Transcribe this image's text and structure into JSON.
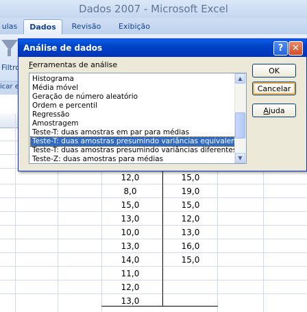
{
  "window": {
    "title": "Dados 2007 - Microsoft Excel"
  },
  "ribbon": {
    "tabs": [
      {
        "label": "ulas"
      },
      {
        "label": "Dados",
        "active": true
      },
      {
        "label": "Revisão"
      },
      {
        "label": "Exibição"
      }
    ],
    "filter_label": "Filtro",
    "group_caption": "icar e"
  },
  "dialog": {
    "title": "Análise de dados",
    "help_label": "?",
    "close_label": "✕",
    "list_label_prefix": "F",
    "list_label_rest": "erramentas de análise",
    "tools": [
      "Histograma",
      "Média móvel",
      "Geração de número aleatório",
      "Ordem e percentil",
      "Regressão",
      "Amostragem",
      "Teste-T: duas amostras em par para médias",
      "Teste-T: duas amostras presumindo variâncias equivalentes",
      "Teste-T: duas amostras presumindo variâncias diferentes",
      "Teste-Z: duas amostras para médias"
    ],
    "selected_index": 7,
    "buttons": {
      "ok": "OK",
      "cancel": "Cancelar",
      "help_prefix": "A",
      "help_rest": "juda"
    }
  },
  "sheet": {
    "col1": [
      "12,0",
      "8,0",
      "15,0",
      "13,0",
      "10,0",
      "13,0",
      "14,0",
      "11,0",
      "12,0",
      "13,0"
    ],
    "col2": [
      "15,0",
      "19,0",
      "15,0",
      "12,0",
      "13,0",
      "16,0",
      "15,0"
    ]
  },
  "colors": {
    "selection": "#316ac5",
    "title_bar": "#0043c7"
  },
  "icons": {
    "filter": "funnel-icon",
    "help": "help-icon",
    "close": "close-icon"
  }
}
